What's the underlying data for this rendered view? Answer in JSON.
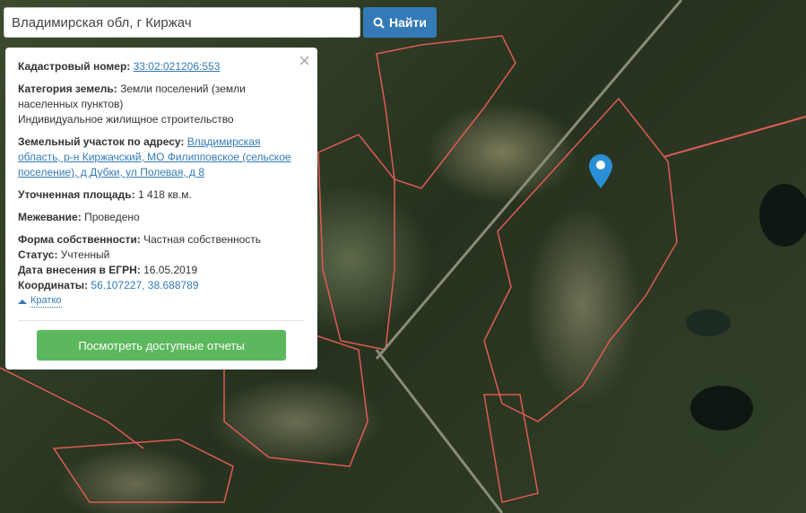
{
  "search": {
    "value": "Владимирская обл, г Киржач",
    "button_label": "Найти"
  },
  "info": {
    "cadastral_label": "Кадастровый номер:",
    "cadastral_value": "33:02:021206:553",
    "category_label": "Категория земель:",
    "category_value": "Земли поселений (земли населенных пунктов)",
    "category_use": "Индивидуальное жилищное строительство",
    "address_label": "Земельный участок по адресу:",
    "address_value": "Владимирская область, р-н Киржачский, МО Филипповское (сельское поселение), д Дубки, ул Полевая, д 8",
    "area_label": "Уточненная площадь:",
    "area_value": "1 418 кв.м.",
    "survey_label": "Межевание:",
    "survey_value": "Проведено",
    "ownership_label": "Форма собственности:",
    "ownership_value": "Частная собственность",
    "status_label": "Статус:",
    "status_value": "Учтенный",
    "date_label": "Дата внесения в ЕГРН:",
    "date_value": "16.05.2019",
    "coords_label": "Координаты:",
    "coords_value": "56.107227, 38.688789",
    "collapse_label": "Кратко",
    "report_button": "Посмотреть доступные отчеты"
  },
  "colors": {
    "primary": "#337ab7",
    "success": "#5cb85c",
    "parcel_border": "#d9534f"
  }
}
